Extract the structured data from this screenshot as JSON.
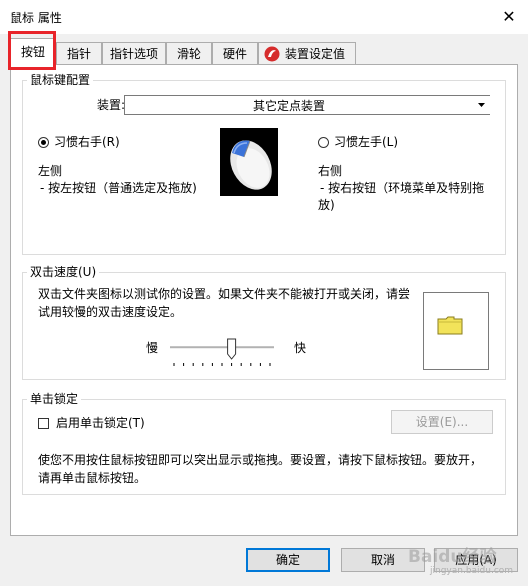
{
  "window": {
    "title": "鼠标 属性",
    "close_glyph": "✕"
  },
  "tabs": [
    {
      "label": "按钮",
      "active": true
    },
    {
      "label": "指针"
    },
    {
      "label": "指针选项"
    },
    {
      "label": "滑轮"
    },
    {
      "label": "硬件"
    },
    {
      "label": "装置设定值",
      "icon": "synaptics-icon"
    }
  ],
  "button_config": {
    "group_label": "鼠标键配置",
    "device_label": "装置: (V)",
    "device_value": "其它定点装置",
    "right_handed_label": "习惯右手(R)",
    "right_handed_selected": true,
    "left_handed_label": "习惯左手(L)",
    "left_handed_selected": false,
    "left_side_title": "左侧",
    "left_side_desc": "- 按左按钮（普通选定及拖放)",
    "right_side_title": "右侧",
    "right_side_desc_line1": "- 按右按钮（环境菜单及特别拖",
    "right_side_desc_line2": "放)"
  },
  "double_click": {
    "group_label": "双击速度(U)",
    "desc_line1": "双击文件夹图标以测试你的设置。如果文件夹不能被打开或关闭，请尝",
    "desc_line2": "试用较慢的双击速度设定。",
    "slow_label": "慢",
    "fast_label": "快",
    "speed_fraction": 0.6
  },
  "click_lock": {
    "group_label": "单击锁定",
    "checkbox_label": "启用单击锁定(T)",
    "checked": false,
    "settings_button": "设置(E)...",
    "desc_line1": "使您不用按住鼠标按钮即可以突出显示或拖拽。要设置，请按下鼠标按钮。要放开，",
    "desc_line2": "请再单击鼠标按钮。"
  },
  "footer": {
    "ok": "确定",
    "cancel": "取消",
    "apply": "应用(A)"
  },
  "watermark": {
    "text": "Baidu经验",
    "sub": "jingyan.baidu.com"
  },
  "colors": {
    "highlight_box": "#e8242a",
    "default_button_border": "#0078d7",
    "folder_yellow": "#f2e35a"
  }
}
